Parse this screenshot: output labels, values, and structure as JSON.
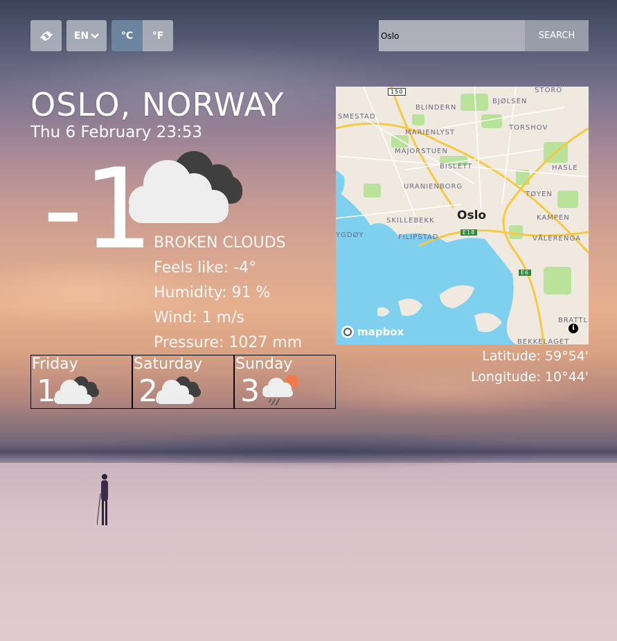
{
  "controls": {
    "language": "EN",
    "celsius": "°C",
    "fahrenheit": "°F"
  },
  "search": {
    "value": "Oslo",
    "button": "SEARCH"
  },
  "location": {
    "title": "OSLO, NORWAY",
    "datetime": "Thu 6 February 23:53"
  },
  "current": {
    "temperature": "-1",
    "condition": "BROKEN CLOUDS",
    "feels_like": "Feels like: -4°",
    "humidity": "Humidity: 91 %",
    "wind": "Wind: 1 m/s",
    "pressure": "Pressure: 1027 mm",
    "icon": "broken-clouds-icon"
  },
  "forecast": [
    {
      "day": "Friday",
      "temp": "1",
      "icon": "broken-clouds-icon"
    },
    {
      "day": "Saturday",
      "temp": "2",
      "icon": "broken-clouds-icon"
    },
    {
      "day": "Sunday",
      "temp": "3",
      "icon": "rain-cloud-sun-icon"
    }
  ],
  "map": {
    "city_label": "Oslo",
    "labels": [
      "SMESTAD",
      "BLINDERN",
      "BJØLSEN",
      "STORO",
      "MARIENLYST",
      "TORSHOV",
      "MAJORSTUEN",
      "BISLETT",
      "HASLE",
      "URANIENBORG",
      "TØYEN",
      "SKILLEBEKK",
      "KAMPEN",
      "YGDØY",
      "FILIPSTAD",
      "VÅLERENGA",
      "BRATTL",
      "BEKKELAGET"
    ],
    "road_labels": [
      "150",
      "E18",
      "E6"
    ],
    "attribution": "mapbox"
  },
  "coordinates": {
    "latitude": "Latitude: 59°54'",
    "longitude": "Longitude: 10°44'"
  },
  "colors": {
    "unit_active": "#6e87a0",
    "button_bg": "#b4b9c3",
    "water": "#7fcfee",
    "park": "#b9e39a"
  }
}
